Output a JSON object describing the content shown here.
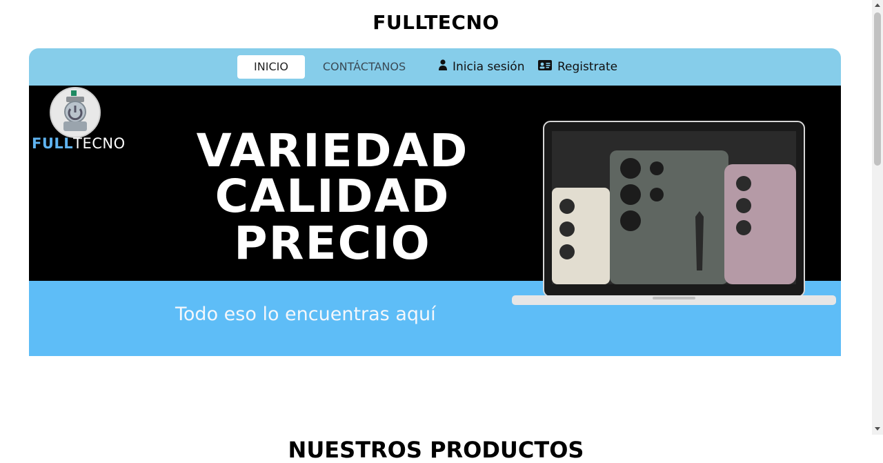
{
  "site": {
    "title": "FULLTECNO"
  },
  "nav": {
    "items": [
      {
        "label": "INICIO",
        "active": true
      },
      {
        "label": "CONTÁCTANOS",
        "active": false
      }
    ],
    "login_label": "Inicia sesión",
    "register_label": "Registrate"
  },
  "banner": {
    "logo_text_bold": "FULL",
    "logo_text_rest": "TECNO",
    "headline": [
      "VARIEDAD",
      "CALIDAD",
      "PRECIO"
    ],
    "tagline": "Todo eso lo encuentras aquí"
  },
  "products": {
    "title": "NUESTROS PRODUCTOS"
  },
  "colors": {
    "nav_bg": "#86cdea",
    "banner_bottom": "#5ebdf7",
    "banner_top": "#000000"
  }
}
